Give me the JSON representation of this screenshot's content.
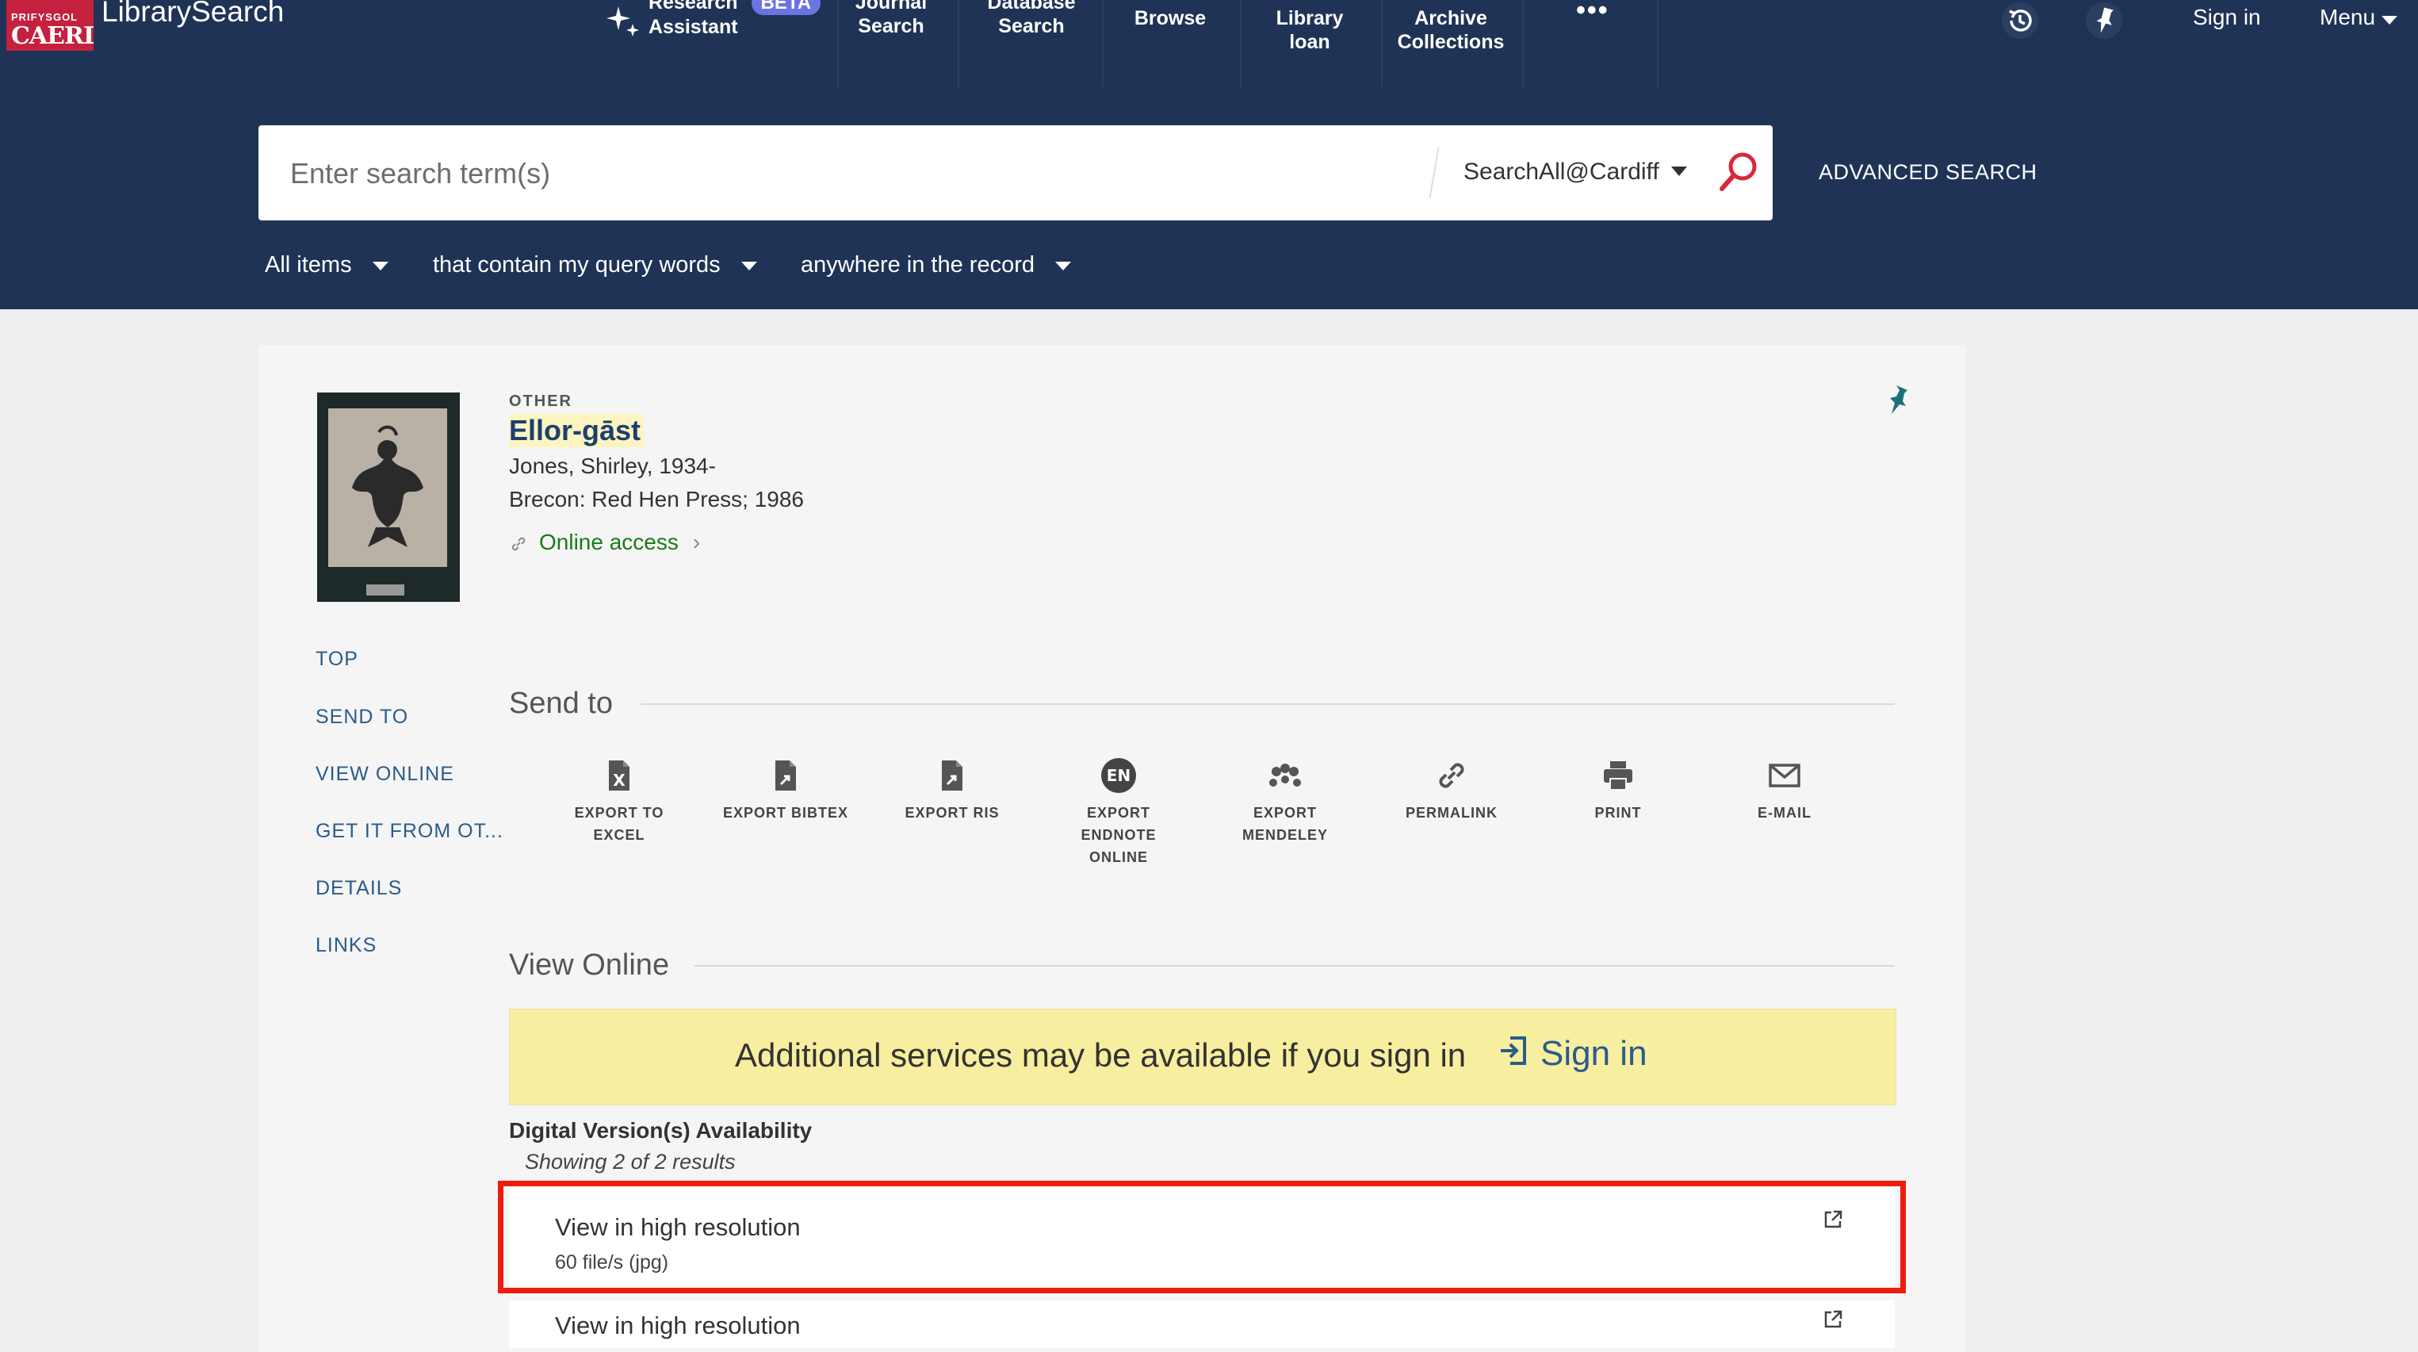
{
  "header": {
    "logo_line1": "PRIFYSGOL",
    "logo_line2": "CAERDYDD",
    "brand": "LibrarySearch",
    "nav": {
      "research_line1": "Research",
      "research_line2": "Assistant",
      "beta": "BETA",
      "journal_line1": "Journal",
      "journal_line2": "Search",
      "database_line1": "Database",
      "database_line2": "Search",
      "browse": "Browse",
      "library_line2": "Library",
      "library_line3": "loan",
      "archive_line2": "Archive",
      "archive_line3": "Collections",
      "more": "•••"
    },
    "sign_in": "Sign in",
    "menu": "Menu"
  },
  "search": {
    "placeholder": "Enter search term(s)",
    "value": "",
    "scope": "SearchAll@Cardiff",
    "advanced": "ADVANCED SEARCH",
    "filters": [
      "All items",
      "that contain my query words",
      "anywhere in the record"
    ]
  },
  "record": {
    "type": "OTHER",
    "title": "Ellor-gāst",
    "author": "Jones, Shirley, 1934-",
    "publication": "Brecon: Red Hen Press; 1986",
    "online_access": "Online access"
  },
  "side_nav": [
    "TOP",
    "SEND TO",
    "VIEW ONLINE",
    "GET IT FROM OT...",
    "DETAILS",
    "LINKS"
  ],
  "send_to": {
    "title": "Send to",
    "actions": [
      {
        "icon": "export-excel-icon",
        "line1": "EXPORT TO",
        "line2": "EXCEL",
        "line3": ""
      },
      {
        "icon": "export-bibtex-icon",
        "line1": "EXPORT BIBTEX",
        "line2": "",
        "line3": ""
      },
      {
        "icon": "export-ris-icon",
        "line1": "EXPORT RIS",
        "line2": "",
        "line3": ""
      },
      {
        "icon": "endnote-icon",
        "line1": "EXPORT",
        "line2": "ENDNOTE",
        "line3": "ONLINE",
        "badge": "EN"
      },
      {
        "icon": "mendeley-icon",
        "line1": "EXPORT",
        "line2": "MENDELEY",
        "line3": ""
      },
      {
        "icon": "permalink-icon",
        "line1": "PERMALINK",
        "line2": "",
        "line3": ""
      },
      {
        "icon": "print-icon",
        "line1": "PRINT",
        "line2": "",
        "line3": ""
      },
      {
        "icon": "email-icon",
        "line1": "E-MAIL",
        "line2": "",
        "line3": ""
      }
    ]
  },
  "view_online": {
    "title": "View Online",
    "banner_text": "Additional services may be available if you sign in",
    "banner_signin": "Sign in",
    "digital_heading": "Digital Version(s) Availability",
    "showing": "Showing 2 of 2 results",
    "items": [
      {
        "title": "View in high resolution",
        "subtitle": "60 file/s (jpg)"
      },
      {
        "title": "View in high resolution",
        "subtitle": ""
      }
    ]
  },
  "colors": {
    "header_bg": "#1f3356",
    "brand_red": "#c5203e",
    "link_blue": "#2a5b8a",
    "online_green": "#1a7a1a",
    "banner_yellow": "#f7ee9f",
    "highlight_red": "#ef1c0e"
  }
}
